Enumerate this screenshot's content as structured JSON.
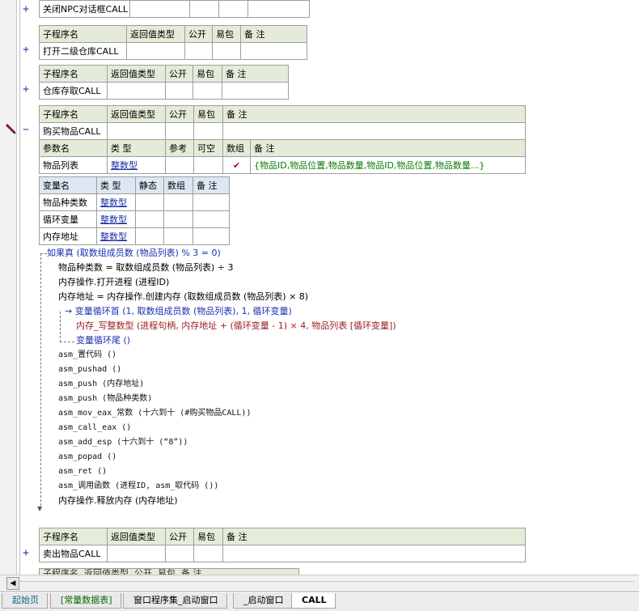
{
  "sub_header_labels": {
    "name": "子程序名",
    "ret_type": "返回值类型",
    "public": "公开",
    "easy_pack": "易包",
    "note": "备 注"
  },
  "subs": [
    {
      "name": "关闭NPC对话框CALL",
      "expanded": false
    },
    {
      "name": "打开二级仓库CALL",
      "expanded": false
    },
    {
      "name": "仓库存取CALL",
      "expanded": false
    },
    {
      "name": "购买物品CALL",
      "expanded": true
    },
    {
      "name": "卖出物品CALL",
      "expanded": false
    }
  ],
  "param_header": {
    "name": "参数名",
    "type": "类 型",
    "ref": "参考",
    "nullable": "可空",
    "array": "数组",
    "note": "备 注"
  },
  "param_row": {
    "name": "物品列表",
    "type": "整数型",
    "array_check": "✔",
    "note": "{物品ID,物品位置,物品数量,物品ID,物品位置,物品数量...}"
  },
  "var_header": {
    "name": "变量名",
    "type": "类 型",
    "static": "静态",
    "array": "数组",
    "note": "备 注"
  },
  "vars": [
    {
      "name": "物品种类数",
      "type": "整数型"
    },
    {
      "name": "循环变量",
      "type": "整数型"
    },
    {
      "name": "内存地址",
      "type": "整数型"
    }
  ],
  "code": {
    "if_line": "如果真 (取数组成员数 (物品列表) % 3 = 0)",
    "l1": "物品种类数 = 取数组成员数 (物品列表) ÷ 3",
    "l2": "内存操作.打开进程 (进程ID)",
    "l3": "内存地址 = 内存操作.创建内存 (取数组成员数 (物品列表) × 8)",
    "loop_head": "变量循环首 (1, 取数组成员数 (物品列表), 1, 循环变量)",
    "loop_body": "内存_写整数型 (进程句柄, 内存地址 + (循环变量 - 1) × 4, 物品列表 [循环变量])",
    "loop_tail": "变量循环尾 ()",
    "asm": [
      "asm_置代码 ()",
      "asm_pushad ()",
      "asm_push (内存地址)",
      "asm_push (物品种类数)",
      "asm_mov_eax_常数 (十六到十 (#购买物品CALL))",
      "asm_call_eax ()",
      "asm_add_esp (十六到十 (“8”))",
      "asm_popad ()",
      "asm_ret ()",
      "asm_调用函数 (进程ID, asm_取代码 ())"
    ],
    "last": "内存操作.释放内存 (内存地址)"
  },
  "expander_symbols": {
    "collapsed": "+",
    "expanded": "−"
  },
  "partial_header": "子程序名  返回值类型  公开  易包  备 注",
  "tabs": [
    {
      "label": "起始页",
      "style": "teal",
      "active": false
    },
    {
      "label": "[常量数据表]",
      "style": "green",
      "active": false
    },
    {
      "label": "窗口程序集_启动窗口",
      "style": "",
      "active": false
    },
    {
      "label": "_启动窗口",
      "style": "",
      "active": false
    },
    {
      "label": "CALL",
      "style": "",
      "active": true
    }
  ],
  "colors": {
    "header_bg": "#e4ecd9",
    "var_header_bg": "#dde6f2",
    "type_link": "#1b2fa7",
    "note_green": "#0a7a0a",
    "check_red": "#c00000"
  }
}
